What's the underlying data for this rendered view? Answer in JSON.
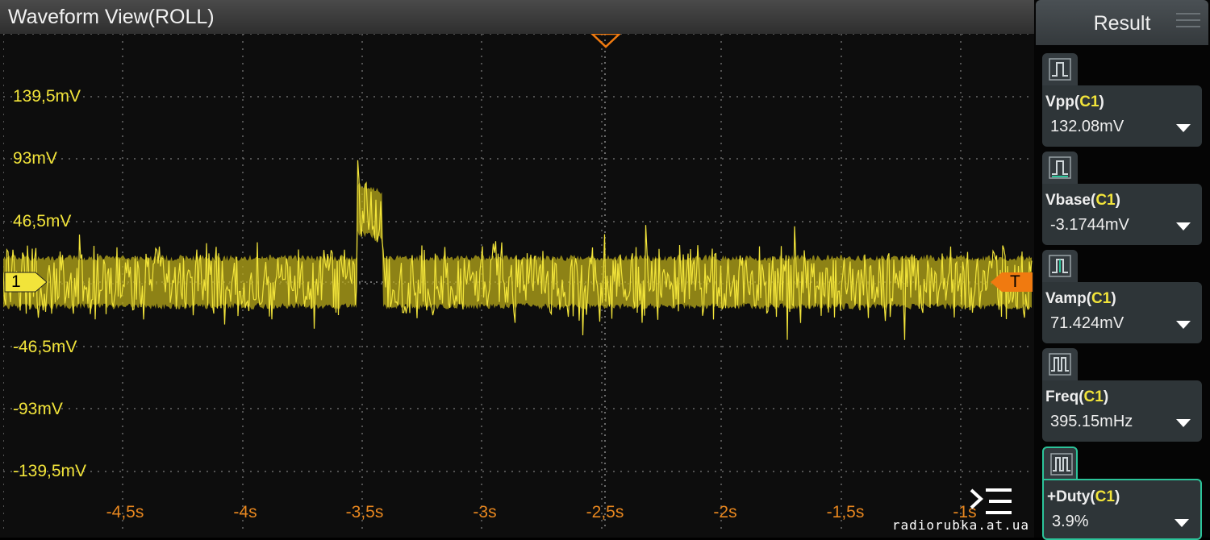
{
  "window": {
    "title": "Waveform View(ROLL)"
  },
  "axes": {
    "y_labels": [
      "139,5mV",
      "93mV",
      "46,5mV",
      "-46,5mV",
      "-93mV",
      "-139,5mV"
    ],
    "x_labels": [
      "-4,5s",
      "-4s",
      "-3,5s",
      "-3s",
      "-2,5s",
      "-2s",
      "-1,5s",
      "-1s"
    ]
  },
  "markers": {
    "channel": "1",
    "trigger": "T"
  },
  "colors": {
    "trace": "#f2e43a",
    "grid": "#6a6a6a",
    "trigger": "#f07a10",
    "active": "#2cc49a"
  },
  "panel": {
    "title": "Result",
    "measurements": [
      {
        "name": "Vpp",
        "channel": "C1",
        "value": "132.08mV",
        "icon": "pulse-measure-icon"
      },
      {
        "name": "Vbase",
        "channel": "C1",
        "value": "-3.1744mV",
        "icon": "base-measure-icon"
      },
      {
        "name": "Vamp",
        "channel": "C1",
        "value": "71.424mV",
        "icon": "amplitude-measure-icon"
      },
      {
        "name": "Freq",
        "channel": "C1",
        "value": "395.15mHz",
        "icon": "frequency-measure-icon"
      },
      {
        "name": "+Duty",
        "channel": "C1",
        "value": "3.9%",
        "icon": "duty-measure-icon",
        "active": true
      }
    ]
  },
  "watermark": "radiorubka.at.ua"
}
